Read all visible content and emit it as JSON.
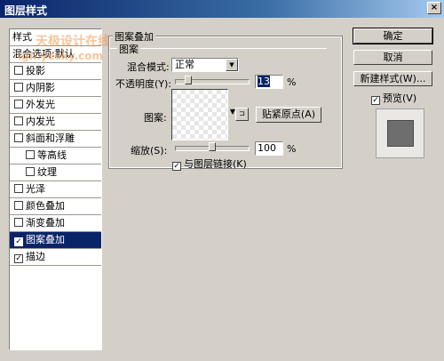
{
  "window": {
    "title": "图层样式",
    "close_glyph": "×"
  },
  "sidebar": {
    "header": "样式",
    "blend_default": "混合选项:默认",
    "items": [
      {
        "label": "投影",
        "checked": false,
        "check": ""
      },
      {
        "label": "内阴影",
        "checked": false,
        "check": ""
      },
      {
        "label": "外发光",
        "checked": false,
        "check": ""
      },
      {
        "label": "内发光",
        "checked": false,
        "check": ""
      },
      {
        "label": "斜面和浮雕",
        "checked": false,
        "check": ""
      },
      {
        "label": "等高线",
        "checked": false,
        "check": ""
      },
      {
        "label": "纹理",
        "checked": false,
        "check": ""
      },
      {
        "label": "光泽",
        "checked": false,
        "check": ""
      },
      {
        "label": "颜色叠加",
        "checked": false,
        "check": ""
      },
      {
        "label": "渐变叠加",
        "checked": false,
        "check": ""
      },
      {
        "label": "图案叠加",
        "checked": true,
        "check": "✓"
      },
      {
        "label": "描边",
        "checked": true,
        "check": "✓"
      }
    ]
  },
  "watermark": {
    "line1": "天极设计在线",
    "line2": "ign.yesky.com"
  },
  "panel": {
    "group_title": "图案叠加",
    "subgroup_title": "图案",
    "blend_mode_label": "混合模式:",
    "blend_mode_value": "正常",
    "opacity_label": "不透明度(Y):",
    "opacity_value": "13",
    "opacity_level": 0.13,
    "percent": "%",
    "pattern_label": "图案:",
    "new_preset_glyph": "⊐",
    "snap_origin_button": "贴紧原点(A)",
    "scale_label": "缩放(S):",
    "scale_value": "100",
    "scale_level": 0.5,
    "link_label": "与图层链接(K)",
    "link_checked": true,
    "check": "✓",
    "dropdown_glyph": "▼"
  },
  "buttons": {
    "ok": "确定",
    "cancel": "取消",
    "new_style": "新建样式(W)..."
  },
  "preview": {
    "label": "预览(V)",
    "checked": true,
    "check": "✓"
  }
}
